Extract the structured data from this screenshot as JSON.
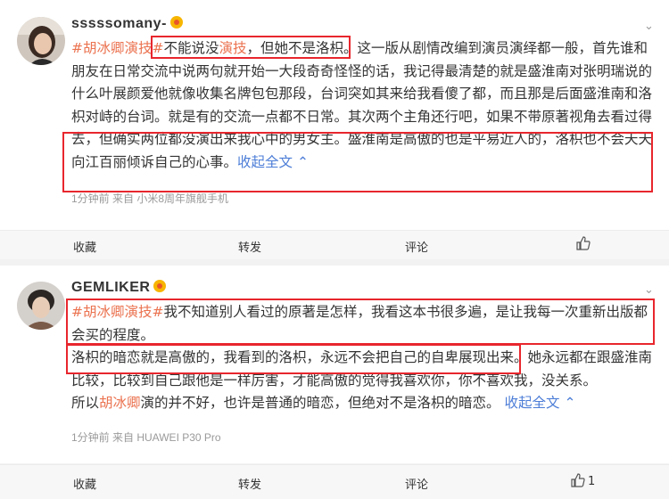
{
  "posts": [
    {
      "username": "sssssomany-",
      "text": {
        "tag": "#胡冰卿演技#",
        "l1a": "不能说没",
        "l1b": "演技",
        "l1c": "，但她不是洛枳。这一版从剧情改编到演员演绎都一般，首先谁和",
        "l2": "朋友在日常交流中说两句就开始一大段奇奇怪怪的话，我记得最清楚的就是盛淮南对张明瑞说的",
        "l3": "什么叶展颜爱他就像收集名牌包包那段，台词突如其来给我看傻了都，而且那是后面盛淮南和洛",
        "l4": "枳对峙的台词。就是有的交流一点都不日常。其次两个主角还行吧，如果不带原著视角去看过得",
        "l5": "去，但确实两位都没演出来我心中的男女主。盛淮南是高傲的也是平易近人的，洛枳也不会天天",
        "l6": "向江百丽倾诉自己的心事。",
        "collapse": "收起全文"
      },
      "meta": "1分钟前  来自 小米8周年旗舰手机",
      "actions": {
        "collect": "收藏",
        "repost": "转发",
        "comment": "评论",
        "like_count": ""
      }
    },
    {
      "username": "GEMLIKER",
      "text": {
        "tag": "#胡冰卿演技#",
        "l1": "我不知道别人看过的原著是怎样，我看这本书很多遍，是让我每一次重新出版都",
        "l2": "会买的程度。",
        "l3a": "洛枳的暗恋就是高傲的，我看到的洛枳，永远不会把自己的自卑展现出来。",
        "l3b": "她永远都在跟盛淮南",
        "l4": "比较，比较到自己跟他是一样厉害，才能高傲的觉得我喜欢你，你不喜欢我，没关系。",
        "l5a": "所以",
        "l5link": "胡冰卿",
        "l5b": "演的并不好，也许是普通的暗恋，但绝对不是洛枳的暗恋。",
        "collapse": "收起全文"
      },
      "meta": "1分钟前  来自 HUAWEI P30 Pro",
      "actions": {
        "collect": "收藏",
        "repost": "转发",
        "comment": "评论",
        "like_count": "1"
      }
    }
  ],
  "colors": {
    "tag": "#eb7350",
    "more": "#4c7dd7",
    "highlight": "#e8262d"
  },
  "icons": {
    "expand": "chevron-down-icon",
    "like": "thumbs-up-icon",
    "vip": "vip-badge-icon"
  }
}
